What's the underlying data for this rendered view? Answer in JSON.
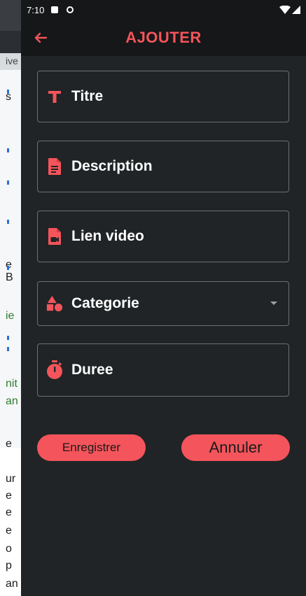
{
  "status_bar": {
    "time": "7:10"
  },
  "app_bar": {
    "title": "AJOUTER"
  },
  "form": {
    "fields": [
      {
        "label": "Titre",
        "icon": "text-title-icon"
      },
      {
        "label": "Description",
        "icon": "document-icon"
      },
      {
        "label": "Lien video",
        "icon": "video-file-icon"
      },
      {
        "label": "Categorie",
        "icon": "shapes-icon"
      },
      {
        "label": "Duree",
        "icon": "timer-icon"
      }
    ]
  },
  "buttons": {
    "save_label": "Enregistrer",
    "cancel_label": "Annuler"
  },
  "background": {
    "snippets": [
      "ive",
      "s",
      "e B",
      "ie",
      "nit",
      "an",
      "e",
      "ur",
      "e",
      "e",
      "e",
      "o",
      "p",
      "an"
    ]
  },
  "colors": {
    "accent": "#f4545b",
    "surface": "#202426",
    "bar": "#151718",
    "outline": "#6c7074"
  }
}
